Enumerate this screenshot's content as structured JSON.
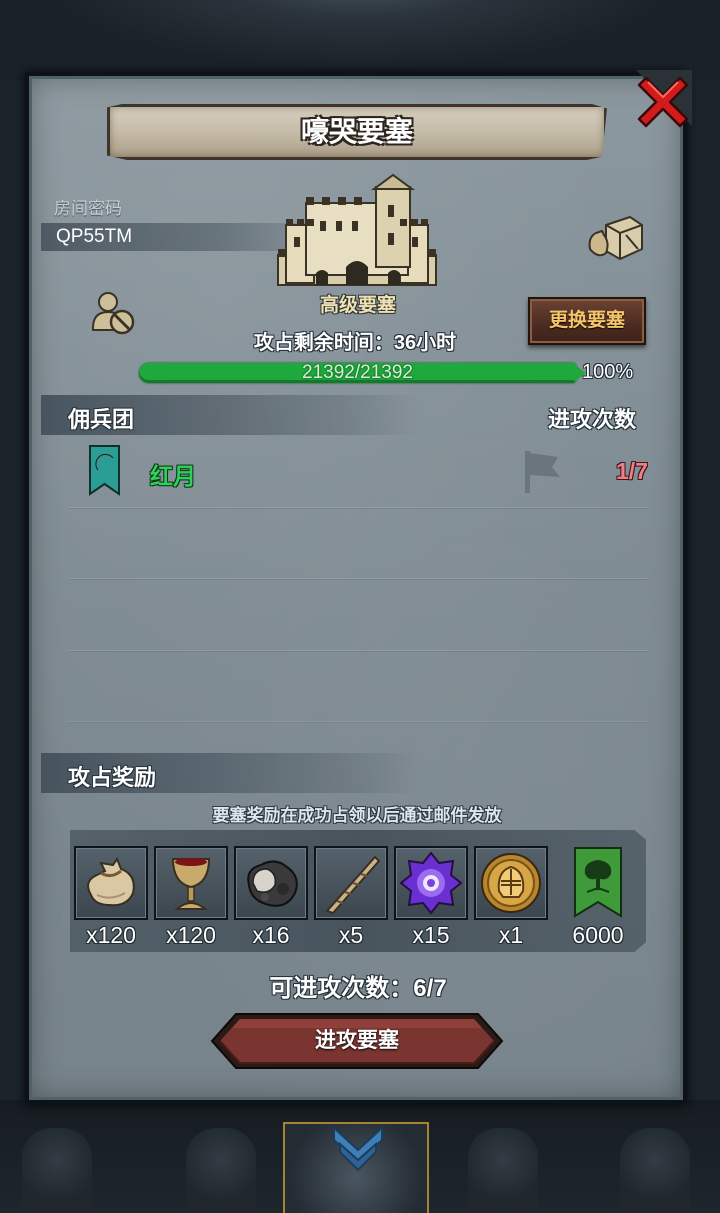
{
  "window": {
    "title": "嚎哭要塞"
  },
  "room": {
    "label": "房间密码",
    "code": "QP55TM"
  },
  "fortress": {
    "type": "高级要塞",
    "change_button": "更换要塞",
    "remaining_time": "攻占剩余时间：36小时",
    "hp_text": "21392/21392",
    "hp_fraction": 1.0,
    "hp_percent": "100%"
  },
  "mercenary": {
    "header": "佣兵团",
    "attacks_header": "进攻次数",
    "rows": [
      {
        "name": "红月",
        "attacks": "1/7"
      }
    ]
  },
  "rewards": {
    "header": "攻占奖励",
    "note": "要塞奖励在成功占领以后通过邮件发放",
    "items": [
      {
        "icon": "sack-icon",
        "qty": "x120"
      },
      {
        "icon": "goblet-icon",
        "qty": "x120"
      },
      {
        "icon": "ore-icon",
        "qty": "x16"
      },
      {
        "icon": "horn-icon",
        "qty": "x5"
      },
      {
        "icon": "purple-gem-icon",
        "qty": "x15"
      },
      {
        "icon": "helmet-coin-icon",
        "qty": "x1"
      },
      {
        "icon": "tree-banner-icon",
        "qty": "6000"
      }
    ]
  },
  "footer": {
    "attack_count": "可进攻次数：6/7",
    "attack_button": "进攻要塞"
  },
  "colors": {
    "hp_green": "#1fa83e",
    "merc_name": "#2ed05a",
    "attacks_red": "#f17e86",
    "change_button_text": "#f5c56a"
  }
}
